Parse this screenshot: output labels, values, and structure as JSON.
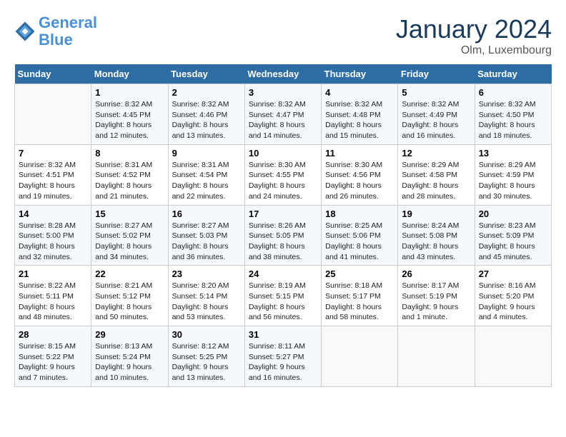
{
  "logo": {
    "line1": "General",
    "line2": "Blue"
  },
  "title": "January 2024",
  "subtitle": "Olm, Luxembourg",
  "days_header": [
    "Sunday",
    "Monday",
    "Tuesday",
    "Wednesday",
    "Thursday",
    "Friday",
    "Saturday"
  ],
  "weeks": [
    [
      {
        "num": "",
        "sunrise": "",
        "sunset": "",
        "daylight": ""
      },
      {
        "num": "1",
        "sunrise": "Sunrise: 8:32 AM",
        "sunset": "Sunset: 4:45 PM",
        "daylight": "Daylight: 8 hours and 12 minutes."
      },
      {
        "num": "2",
        "sunrise": "Sunrise: 8:32 AM",
        "sunset": "Sunset: 4:46 PM",
        "daylight": "Daylight: 8 hours and 13 minutes."
      },
      {
        "num": "3",
        "sunrise": "Sunrise: 8:32 AM",
        "sunset": "Sunset: 4:47 PM",
        "daylight": "Daylight: 8 hours and 14 minutes."
      },
      {
        "num": "4",
        "sunrise": "Sunrise: 8:32 AM",
        "sunset": "Sunset: 4:48 PM",
        "daylight": "Daylight: 8 hours and 15 minutes."
      },
      {
        "num": "5",
        "sunrise": "Sunrise: 8:32 AM",
        "sunset": "Sunset: 4:49 PM",
        "daylight": "Daylight: 8 hours and 16 minutes."
      },
      {
        "num": "6",
        "sunrise": "Sunrise: 8:32 AM",
        "sunset": "Sunset: 4:50 PM",
        "daylight": "Daylight: 8 hours and 18 minutes."
      }
    ],
    [
      {
        "num": "7",
        "sunrise": "Sunrise: 8:32 AM",
        "sunset": "Sunset: 4:51 PM",
        "daylight": "Daylight: 8 hours and 19 minutes."
      },
      {
        "num": "8",
        "sunrise": "Sunrise: 8:31 AM",
        "sunset": "Sunset: 4:52 PM",
        "daylight": "Daylight: 8 hours and 21 minutes."
      },
      {
        "num": "9",
        "sunrise": "Sunrise: 8:31 AM",
        "sunset": "Sunset: 4:54 PM",
        "daylight": "Daylight: 8 hours and 22 minutes."
      },
      {
        "num": "10",
        "sunrise": "Sunrise: 8:30 AM",
        "sunset": "Sunset: 4:55 PM",
        "daylight": "Daylight: 8 hours and 24 minutes."
      },
      {
        "num": "11",
        "sunrise": "Sunrise: 8:30 AM",
        "sunset": "Sunset: 4:56 PM",
        "daylight": "Daylight: 8 hours and 26 minutes."
      },
      {
        "num": "12",
        "sunrise": "Sunrise: 8:29 AM",
        "sunset": "Sunset: 4:58 PM",
        "daylight": "Daylight: 8 hours and 28 minutes."
      },
      {
        "num": "13",
        "sunrise": "Sunrise: 8:29 AM",
        "sunset": "Sunset: 4:59 PM",
        "daylight": "Daylight: 8 hours and 30 minutes."
      }
    ],
    [
      {
        "num": "14",
        "sunrise": "Sunrise: 8:28 AM",
        "sunset": "Sunset: 5:00 PM",
        "daylight": "Daylight: 8 hours and 32 minutes."
      },
      {
        "num": "15",
        "sunrise": "Sunrise: 8:27 AM",
        "sunset": "Sunset: 5:02 PM",
        "daylight": "Daylight: 8 hours and 34 minutes."
      },
      {
        "num": "16",
        "sunrise": "Sunrise: 8:27 AM",
        "sunset": "Sunset: 5:03 PM",
        "daylight": "Daylight: 8 hours and 36 minutes."
      },
      {
        "num": "17",
        "sunrise": "Sunrise: 8:26 AM",
        "sunset": "Sunset: 5:05 PM",
        "daylight": "Daylight: 8 hours and 38 minutes."
      },
      {
        "num": "18",
        "sunrise": "Sunrise: 8:25 AM",
        "sunset": "Sunset: 5:06 PM",
        "daylight": "Daylight: 8 hours and 41 minutes."
      },
      {
        "num": "19",
        "sunrise": "Sunrise: 8:24 AM",
        "sunset": "Sunset: 5:08 PM",
        "daylight": "Daylight: 8 hours and 43 minutes."
      },
      {
        "num": "20",
        "sunrise": "Sunrise: 8:23 AM",
        "sunset": "Sunset: 5:09 PM",
        "daylight": "Daylight: 8 hours and 45 minutes."
      }
    ],
    [
      {
        "num": "21",
        "sunrise": "Sunrise: 8:22 AM",
        "sunset": "Sunset: 5:11 PM",
        "daylight": "Daylight: 8 hours and 48 minutes."
      },
      {
        "num": "22",
        "sunrise": "Sunrise: 8:21 AM",
        "sunset": "Sunset: 5:12 PM",
        "daylight": "Daylight: 8 hours and 50 minutes."
      },
      {
        "num": "23",
        "sunrise": "Sunrise: 8:20 AM",
        "sunset": "Sunset: 5:14 PM",
        "daylight": "Daylight: 8 hours and 53 minutes."
      },
      {
        "num": "24",
        "sunrise": "Sunrise: 8:19 AM",
        "sunset": "Sunset: 5:15 PM",
        "daylight": "Daylight: 8 hours and 56 minutes."
      },
      {
        "num": "25",
        "sunrise": "Sunrise: 8:18 AM",
        "sunset": "Sunset: 5:17 PM",
        "daylight": "Daylight: 8 hours and 58 minutes."
      },
      {
        "num": "26",
        "sunrise": "Sunrise: 8:17 AM",
        "sunset": "Sunset: 5:19 PM",
        "daylight": "Daylight: 9 hours and 1 minute."
      },
      {
        "num": "27",
        "sunrise": "Sunrise: 8:16 AM",
        "sunset": "Sunset: 5:20 PM",
        "daylight": "Daylight: 9 hours and 4 minutes."
      }
    ],
    [
      {
        "num": "28",
        "sunrise": "Sunrise: 8:15 AM",
        "sunset": "Sunset: 5:22 PM",
        "daylight": "Daylight: 9 hours and 7 minutes."
      },
      {
        "num": "29",
        "sunrise": "Sunrise: 8:13 AM",
        "sunset": "Sunset: 5:24 PM",
        "daylight": "Daylight: 9 hours and 10 minutes."
      },
      {
        "num": "30",
        "sunrise": "Sunrise: 8:12 AM",
        "sunset": "Sunset: 5:25 PM",
        "daylight": "Daylight: 9 hours and 13 minutes."
      },
      {
        "num": "31",
        "sunrise": "Sunrise: 8:11 AM",
        "sunset": "Sunset: 5:27 PM",
        "daylight": "Daylight: 9 hours and 16 minutes."
      },
      {
        "num": "",
        "sunrise": "",
        "sunset": "",
        "daylight": ""
      },
      {
        "num": "",
        "sunrise": "",
        "sunset": "",
        "daylight": ""
      },
      {
        "num": "",
        "sunrise": "",
        "sunset": "",
        "daylight": ""
      }
    ]
  ]
}
